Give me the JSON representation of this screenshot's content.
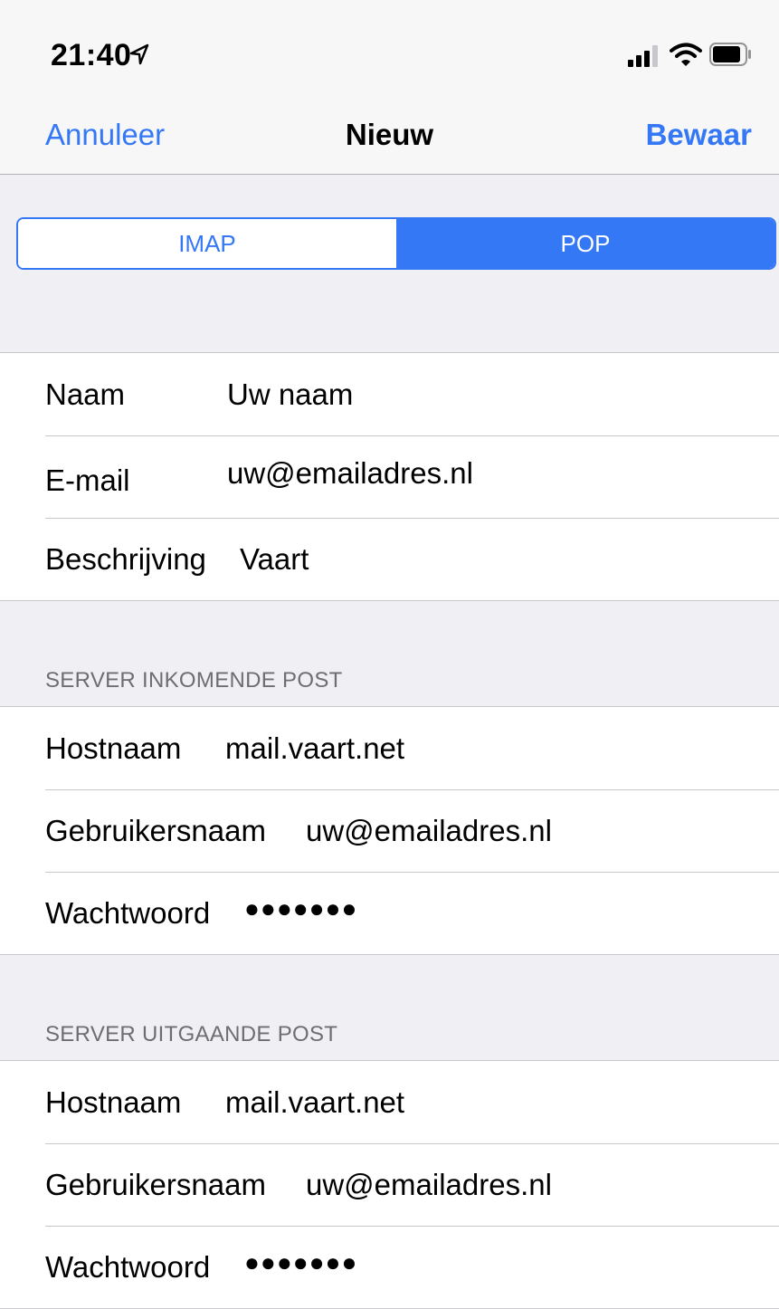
{
  "status_bar": {
    "time": "21:40",
    "icons": [
      "location-arrow-icon",
      "signal-icon",
      "wifi-icon",
      "battery-icon"
    ]
  },
  "nav": {
    "cancel_label": "Annuleer",
    "title": "Nieuw",
    "save_label": "Bewaar"
  },
  "segmented": {
    "options": [
      "IMAP",
      "POP"
    ],
    "selected": "POP"
  },
  "account": {
    "rows": [
      {
        "label": "Naam",
        "value": "Uw naam"
      },
      {
        "label": "E-mail",
        "value": "uw@emailadres.nl"
      },
      {
        "label": "Beschrijving",
        "value": "Vaart"
      }
    ]
  },
  "incoming": {
    "header": "SERVER INKOMENDE POST",
    "rows": [
      {
        "label": "Hostnaam",
        "value": "mail.vaart.net"
      },
      {
        "label": "Gebruikersnaam",
        "value": "uw@emailadres.nl"
      },
      {
        "label": "Wachtwoord",
        "value": "●●●●●●●"
      }
    ]
  },
  "outgoing": {
    "header": "SERVER UITGAANDE POST",
    "rows": [
      {
        "label": "Hostnaam",
        "value": "mail.vaart.net"
      },
      {
        "label": "Gebruikersnaam",
        "value": "uw@emailadres.nl"
      },
      {
        "label": "Wachtwoord",
        "value": "●●●●●●●"
      }
    ]
  },
  "colors": {
    "accent": "#3478f6",
    "background": "#efeff4",
    "separator": "#c8c7cc",
    "header_text": "#6d6d72"
  }
}
